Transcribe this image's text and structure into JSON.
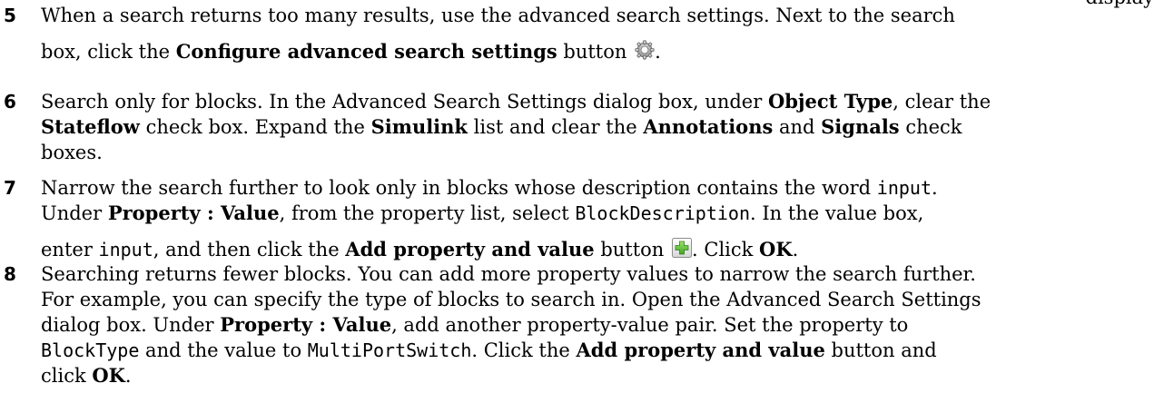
{
  "top_fragment": "display",
  "steps": [
    {
      "number": "5",
      "line1": "When a search returns too many results, use the advanced search settings. Next to the search",
      "line2_pre": "box, click the ",
      "line2_bold": "Configure advanced search settings",
      "line2_post": " button",
      "icon": "gear-icon",
      "after_icon": "."
    },
    {
      "number": "6",
      "t1": "Search only for blocks. In the Advanced Search Settings dialog box, under ",
      "b1": "Object Type",
      "t2": ", clear the",
      "b2": "Stateflow",
      "t3": " check box. Expand the ",
      "b3": "Simulink",
      "t4": " list and clear the ",
      "b4": "Annotations",
      "t5": " and ",
      "b5": "Signals",
      "t6": " check",
      "t7": "boxes."
    },
    {
      "number": "7",
      "t1": "Narrow the search further to look only in blocks whose description contains the word ",
      "c1": "input",
      "t1b": ".",
      "t2": "Under ",
      "b1": "Property : Value",
      "t3": ", from the property list, select ",
      "c2": "BlockDescription",
      "t4": ". In the value box,",
      "t5": "enter ",
      "c3": "input",
      "t6": ", and then click the ",
      "b2": "Add property and value",
      "t7": " button",
      "icon": "add-plus-icon",
      "t8": ". Click ",
      "b3": "OK",
      "t9": "."
    },
    {
      "number": "8",
      "t1": "Searching returns fewer blocks. You can add more property values to narrow the search further.",
      "t2": "For example, you can specify the type of blocks to search in. Open the Advanced Search Settings",
      "t3": "dialog box. Under ",
      "b1": "Property : Value",
      "t4": ", add another property-value pair. Set the property to",
      "c1": "BlockType",
      "t5": " and the value to ",
      "c2": "MultiPortSwitch",
      "t6": ". Click the ",
      "b2": "Add property and value",
      "t7": " button and",
      "t8": "click ",
      "b3": "OK",
      "t9": "."
    }
  ]
}
